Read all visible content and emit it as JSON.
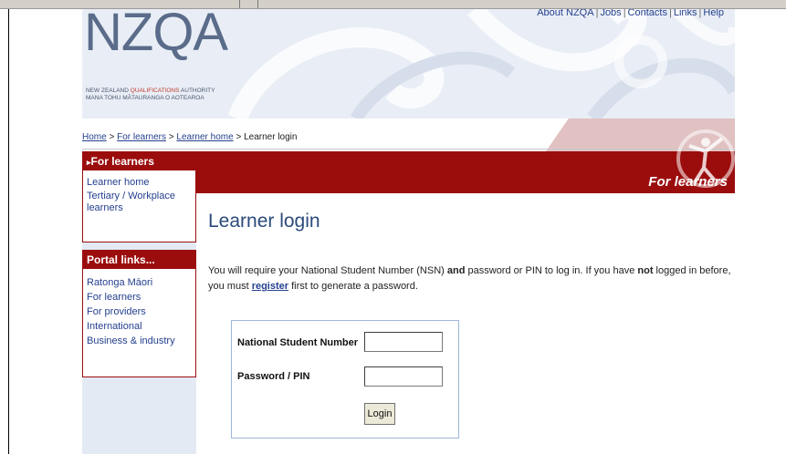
{
  "colors": {
    "brand_red": "#9b0d0d",
    "link_blue": "#25408f",
    "sidebar_bg": "#e4eaf4",
    "header_bg": "#e9eef6"
  },
  "logo": {
    "letters": "NZQA",
    "sub_line1_a": "NEW ZEALAND ",
    "sub_line1_b": "QUALIFICATIONS",
    "sub_line1_c": " AUTHORITY",
    "sub_line2": "MANA TOHU MĀTAURANGA O AOTEAROA"
  },
  "top_links": [
    "About NZQA",
    "Jobs",
    "Contacts",
    "Links",
    "Help"
  ],
  "breadcrumb": {
    "items": [
      "Home",
      "For learners",
      "Learner home"
    ],
    "sep": " > ",
    "current": "Learner login"
  },
  "banner": {
    "title": "For learners"
  },
  "sidebar": {
    "section1": {
      "heading": "For learners",
      "items": [
        "Learner home",
        "Tertiary / Workplace learners"
      ]
    },
    "section2": {
      "heading": "Portal links...",
      "items": [
        "Ratonga Māori",
        "For learners",
        "For providers",
        "International",
        "Business & industry"
      ]
    }
  },
  "main": {
    "title": "Learner login",
    "intro_1": "You will require your National Student Number (NSN) ",
    "intro_and": "and",
    "intro_2": " password or PIN to log in. If you have ",
    "intro_not": "not",
    "intro_3": " logged in before, you must ",
    "intro_register": "register",
    "intro_4": " first to generate a password."
  },
  "login_form": {
    "nsn_label": "National Student Number",
    "nsn_value": "",
    "password_label": "Password / PIN",
    "password_value": "",
    "submit_label": "Login"
  }
}
